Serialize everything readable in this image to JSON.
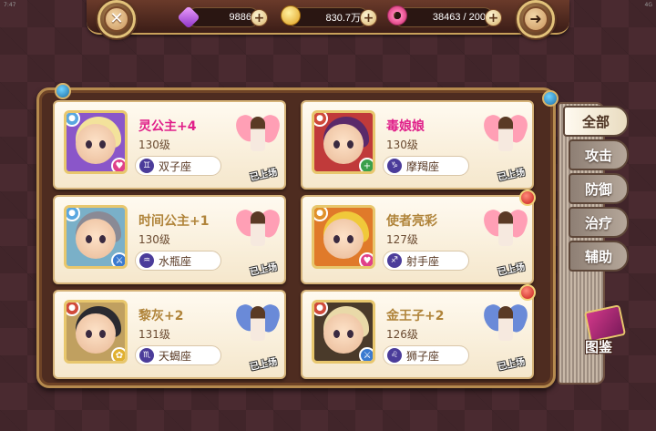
{
  "status_bar": {
    "left": "7:47",
    "right": "4G"
  },
  "currencies": {
    "gems": {
      "value": "9886",
      "icon": "gem-icon"
    },
    "gold": {
      "value": "830.7万",
      "icon": "coin-icon"
    },
    "stamina": {
      "value": "38463 / 200",
      "icon": "donut-icon"
    }
  },
  "top_buttons": {
    "close": "✕",
    "back": "➜"
  },
  "heroes": [
    {
      "name": "灵公主+4",
      "level": "130级",
      "zodiac": "双子座",
      "zodiac_glyph": "♊",
      "deployed": "已上场",
      "name_color": "#e0208a",
      "hair": "#f3e29b",
      "bg": "#8a56c9",
      "element": "#5aa7e0",
      "role": "#e0408a",
      "role_glyph": "♥",
      "fairy_wing": "#ff9fb5",
      "red_dot": false
    },
    {
      "name": "毒娘娘",
      "level": "130级",
      "zodiac": "摩羯座",
      "zodiac_glyph": "♑",
      "deployed": "已上场",
      "name_color": "#e0208a",
      "hair": "#5a2a6a",
      "bg": "#c03a3a",
      "element": "#d04a3a",
      "role": "#3aa04a",
      "role_glyph": "+",
      "fairy_wing": "#ff9fb5",
      "red_dot": false
    },
    {
      "name": "时间公主+1",
      "level": "130级",
      "zodiac": "水瓶座",
      "zodiac_glyph": "♒",
      "deployed": "已上场",
      "name_color": "#b0843a",
      "hair": "#8a8a95",
      "bg": "#7ab0c8",
      "element": "#5aa7e0",
      "role": "#3a7ad0",
      "role_glyph": "⚔",
      "fairy_wing": "#ff9fb5",
      "red_dot": false
    },
    {
      "name": "使者亮彩",
      "level": "127级",
      "zodiac": "射手座",
      "zodiac_glyph": "♐",
      "deployed": "已上场",
      "name_color": "#b0843a",
      "hair": "#f0c93a",
      "bg": "#e07a2a",
      "element": "#e0902a",
      "role": "#e0408a",
      "role_glyph": "♥",
      "fairy_wing": "#ff9fb5",
      "red_dot": true
    },
    {
      "name": "黎灰+2",
      "level": "131级",
      "zodiac": "天蝎座",
      "zodiac_glyph": "♏",
      "deployed": "已上场",
      "name_color": "#b0843a",
      "hair": "#2a2a30",
      "bg": "#c0a060",
      "element": "#d04a3a",
      "role": "#e0b030",
      "role_glyph": "✿",
      "fairy_wing": "#6a8ad8",
      "red_dot": false
    },
    {
      "name": "金王子+2",
      "level": "126级",
      "zodiac": "狮子座",
      "zodiac_glyph": "♌",
      "deployed": "已上场",
      "name_color": "#b0843a",
      "hair": "#e9d9a8",
      "bg": "#4a3a2a",
      "element": "#d04a3a",
      "role": "#3a7ad0",
      "role_glyph": "⚔",
      "fairy_wing": "#6a8ad8",
      "red_dot": true
    }
  ],
  "tabs": [
    "全部",
    "攻击",
    "防御",
    "治疗",
    "辅助"
  ],
  "active_tab": "全部",
  "codex": {
    "label": "图鉴",
    "icon": "codex-book-icon"
  }
}
